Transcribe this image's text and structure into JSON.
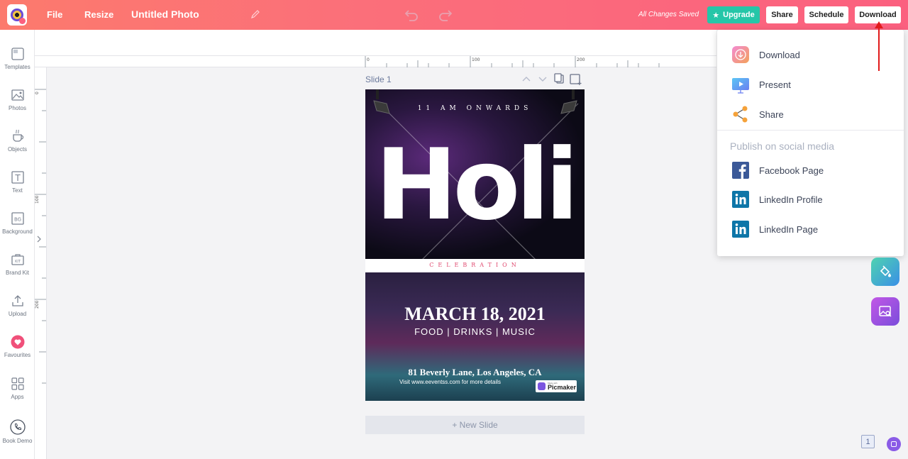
{
  "topbar": {
    "menu_file": "File",
    "menu_resize": "Resize",
    "doc_title": "Untitled Photo",
    "save_status": "All Changes Saved",
    "upgrade_label": "Upgrade",
    "share_label": "Share",
    "schedule_label": "Schedule",
    "download_label": "Download",
    "accent_color": "#fb607f",
    "upgrade_color": "#25c6a8"
  },
  "sidebar": {
    "items": [
      {
        "label": "Templates",
        "icon": "templates-icon"
      },
      {
        "label": "Photos",
        "icon": "photos-icon"
      },
      {
        "label": "Objects",
        "icon": "objects-icon"
      },
      {
        "label": "Text",
        "icon": "text-icon"
      },
      {
        "label": "Background",
        "icon": "background-icon"
      },
      {
        "label": "Brand Kit",
        "icon": "brand-kit-icon"
      },
      {
        "label": "Upload",
        "icon": "upload-icon"
      },
      {
        "label": "Favourites",
        "icon": "heart-icon"
      },
      {
        "label": "Apps",
        "icon": "apps-icon"
      },
      {
        "label": "Book Demo",
        "icon": "phone-icon"
      }
    ],
    "bg_icon_text": "BG",
    "kit_icon_text": "KIT",
    "text_icon_text": "T"
  },
  "rulers": {
    "top_ticks": [
      "0",
      "100",
      "200"
    ],
    "left_ticks": [
      "0",
      "100",
      "200"
    ]
  },
  "slide": {
    "label": "Slide 1",
    "new_slide_label": "+ New Slide",
    "poster": {
      "eyebrow": "11 AM ONWARDS",
      "headline": "Holi",
      "band_text": "CELEBRATION",
      "date": "MARCH 18, 2021",
      "tagline": "FOOD | DRINKS | MUSIC",
      "address": "81 Beverly Lane, Los Angeles, CA",
      "visit": "Visit www.eeventss.com for more details",
      "watermark_small": "Made with",
      "watermark": "Picmaker"
    }
  },
  "download_menu": {
    "items": [
      {
        "label": "Download",
        "icon": "download-icon"
      },
      {
        "label": "Present",
        "icon": "present-icon"
      },
      {
        "label": "Share",
        "icon": "share-icon"
      }
    ],
    "social_heading": "Publish on social media",
    "social_items": [
      {
        "label": "Facebook Page",
        "icon": "facebook-icon"
      },
      {
        "label": "LinkedIn Profile",
        "icon": "linkedin-icon"
      },
      {
        "label": "LinkedIn Page",
        "icon": "linkedin-icon"
      }
    ]
  },
  "footer": {
    "page_number": "1"
  }
}
